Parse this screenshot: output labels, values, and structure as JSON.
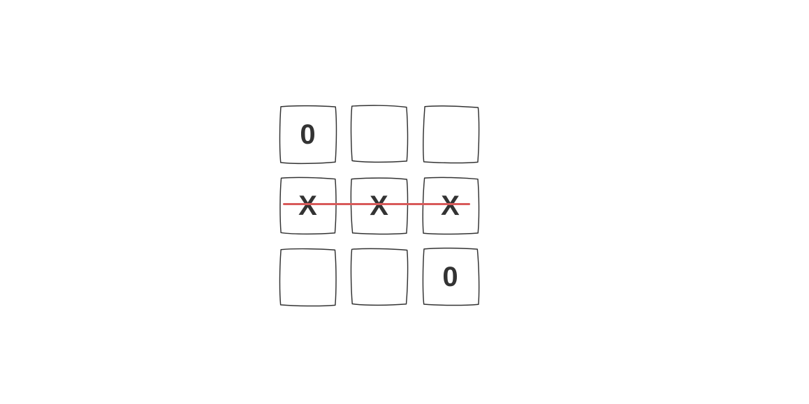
{
  "game": {
    "type": "tic-tac-toe",
    "grid_size": 3,
    "cells": [
      [
        "0",
        "",
        ""
      ],
      [
        "X",
        "X",
        "X"
      ],
      [
        "",
        "",
        "0"
      ]
    ],
    "winner": "X",
    "win_line": {
      "kind": "row",
      "index": 1,
      "color": "#d85a5a"
    }
  }
}
